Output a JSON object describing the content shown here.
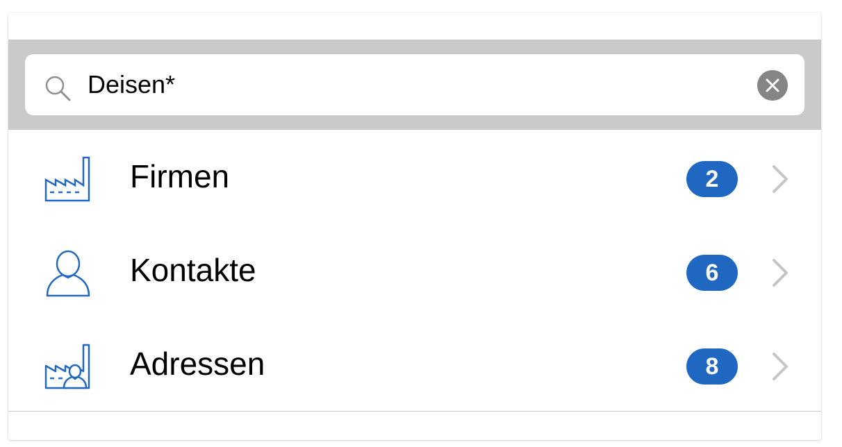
{
  "search": {
    "value": "Deisen*",
    "icon": "search-icon",
    "clear_icon": "clear-icon"
  },
  "colors": {
    "accent": "#2067c1",
    "search_bar_bg": "#cacaca",
    "clear_button_bg": "#858585",
    "chevron": "#c5c5ca"
  },
  "results": [
    {
      "label": "Firmen",
      "count": "2",
      "icon": "factory-icon"
    },
    {
      "label": "Kontakte",
      "count": "6",
      "icon": "person-icon"
    },
    {
      "label": "Adressen",
      "count": "8",
      "icon": "factory-person-icon"
    }
  ]
}
